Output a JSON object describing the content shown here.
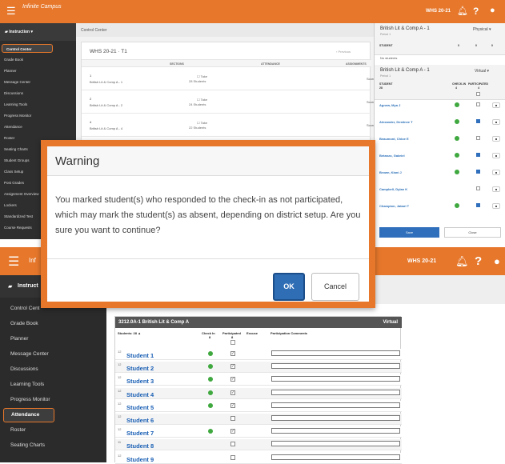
{
  "top_app": {
    "logo": "Infinite Campus",
    "school_year": "WHS 20-21",
    "sidebar_header": "Instruction",
    "sidebar_items": [
      "Control Center",
      "Grade Book",
      "Planner",
      "Message Center",
      "Discussions",
      "Learning Tools",
      "Progress Monitor",
      "Attendance",
      "Roster",
      "Seating Charts",
      "Student Groups",
      "Class Setup",
      "Post Grades",
      "Assignment Overview",
      "Lockers",
      "Standardized Test",
      "Course Requests"
    ],
    "page_title": "Control Center",
    "term": "WHS 20-21 · T1",
    "previous": "‹ Previous",
    "columns": [
      "SECTIONS",
      "ATTENDANCE",
      "ASSIGNMENTS"
    ],
    "sections": [
      {
        "num": "1",
        "name": "British Lit & Comp A - 1",
        "take": "☐ Take",
        "students": "28 Students",
        "score": "Score"
      },
      {
        "num": "2",
        "name": "British Lit & Comp A - 2",
        "take": "☐ Take",
        "students": "24 Students",
        "score": "Score"
      },
      {
        "num": "4",
        "name": "British Lit & Comp A - 4",
        "take": "☐ Take",
        "students": "22 Students",
        "score": "Score"
      }
    ],
    "panel": {
      "physical_title": "British Lit & Comp A - 1",
      "physical_period": "Period 1",
      "physical_mode": "Physical  ▾",
      "physical_cols": [
        "STUDENT",
        "0",
        "0",
        "0"
      ],
      "no_students": "No students",
      "virtual_title": "British Lit & Comp A - 1",
      "virtual_period": "Period 1",
      "virtual_mode": "Virtual  ▾",
      "virtual_cols": [
        "STUDENT",
        "28",
        "CHECK-IN",
        "4",
        "PARTICIPATED",
        "4"
      ],
      "students": [
        {
          "name": "Agnew, Mya J",
          "checked": true,
          "participated": false
        },
        {
          "name": "Alexander, Destinee T",
          "checked": true,
          "participated": true
        },
        {
          "name": "Beaumont, Chloe E",
          "checked": true,
          "participated": false
        },
        {
          "name": "Betanzo, Gabriel",
          "checked": true,
          "participated": true
        },
        {
          "name": "Brown, Kiani J",
          "checked": true,
          "participated": true
        },
        {
          "name": "Campbell, Dylan K",
          "checked": false,
          "participated": false
        },
        {
          "name": "Champion, Jabari T",
          "checked": true,
          "participated": true
        }
      ],
      "save": "Save",
      "close": "Close"
    }
  },
  "bottom_app": {
    "logo": "Inf",
    "school_year": "WHS 20-21",
    "sidebar_header": "Instruct",
    "sidebar_items": [
      "Control Cent",
      "Grade Book",
      "Planner",
      "Message Center",
      "Discussions",
      "Learning Tools",
      "Progress Monitor",
      "Attendance",
      "Roster",
      "Seating Charts"
    ],
    "attendance": {
      "title": "3212.0A-1 British Lit & Comp A",
      "mode": "Virtual",
      "students_label": "Students: 28 ▲",
      "check_in": "Check In",
      "check_in_count": "8",
      "participated": "Participated",
      "participated_count": "8",
      "excuse": "Excuse",
      "comments": "Participation Comments",
      "rows": [
        {
          "grade": "12",
          "name": "Student 1",
          "checked": true,
          "participated": true
        },
        {
          "grade": "12",
          "name": "Student 2",
          "checked": true,
          "participated": true
        },
        {
          "grade": "12",
          "name": "Student 3",
          "checked": true,
          "participated": true
        },
        {
          "grade": "12",
          "name": "Student 4",
          "checked": true,
          "participated": true
        },
        {
          "grade": "12",
          "name": "Student 5",
          "checked": true,
          "participated": true
        },
        {
          "grade": "12",
          "name": "Student 6",
          "checked": false,
          "participated": false
        },
        {
          "grade": "12",
          "name": "Student 7",
          "checked": true,
          "participated": true
        },
        {
          "grade": "11",
          "name": "Student 8",
          "checked": false,
          "participated": false
        },
        {
          "grade": "12",
          "name": "Student 9",
          "checked": false,
          "participated": false
        }
      ]
    }
  },
  "modal": {
    "title": "Warning",
    "message": "You marked student(s) who responded to the check-in as not participated, which may mark the student(s) as absent, depending on district setup. Are you sure you want to continue?",
    "ok": "OK",
    "cancel": "Cancel"
  },
  "colors": {
    "brand": "#e6772b",
    "primary": "#2f6db5",
    "check": "#3fa83f"
  },
  "icons": {
    "menu": "hamburger-icon",
    "notifications": "bell-icon",
    "help": "question-icon",
    "user": "user-icon",
    "check": "check-circle-icon"
  }
}
